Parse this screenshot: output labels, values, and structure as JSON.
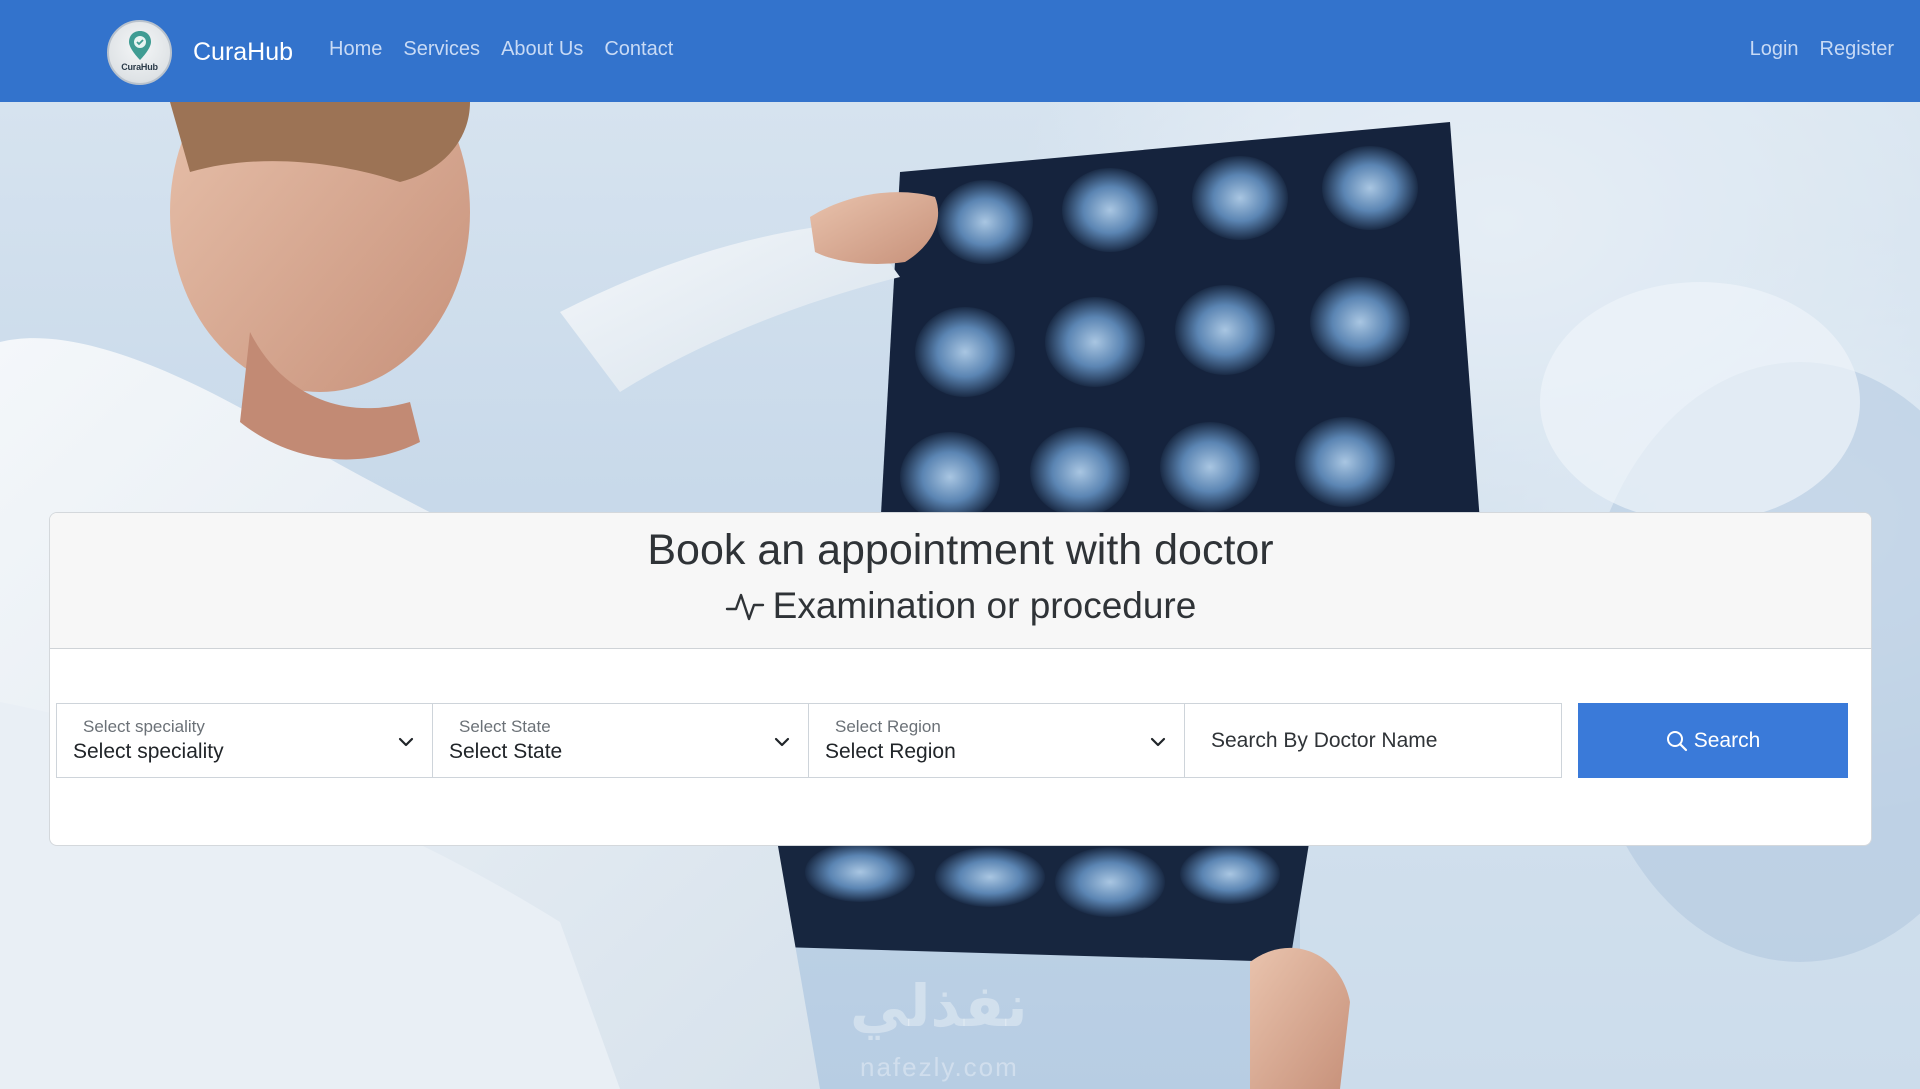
{
  "navbar": {
    "brand": "CuraHub",
    "logo_text": "CuraHub",
    "links": [
      "Home",
      "Services",
      "About Us",
      "Contact"
    ],
    "auth": {
      "login": "Login",
      "register": "Register"
    },
    "background_color": "#3373cc"
  },
  "hero": {
    "watermark": "نفذلي",
    "watermark_sub": "nafezly.com"
  },
  "booking": {
    "title": "Book an appointment with doctor",
    "subtitle": "Examination or procedure",
    "subtitle_icon": "activity-icon",
    "speciality": {
      "label": "Select speciality",
      "value": "Select speciality"
    },
    "state": {
      "label": "Select State",
      "value": "Select State"
    },
    "region": {
      "label": "Select Region",
      "value": "Select Region"
    },
    "doctor_search": {
      "placeholder": "Search By Doctor Name"
    },
    "search_button": {
      "label": "Search",
      "icon": "search-icon",
      "color": "#3a7ad9"
    }
  }
}
